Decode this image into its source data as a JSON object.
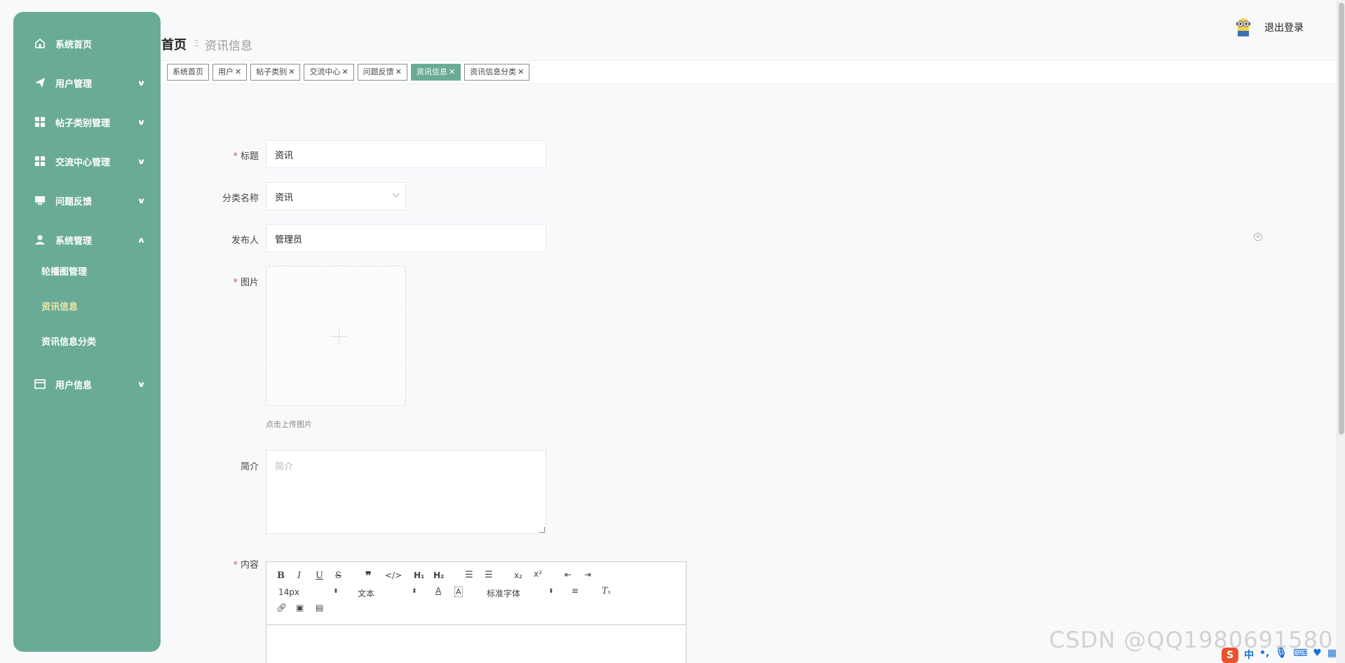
{
  "sidebar": {
    "items": [
      {
        "label": "系统首页",
        "icon": "home-icon"
      },
      {
        "label": "用户管理",
        "icon": "send-icon"
      },
      {
        "label": "帖子类别管理",
        "icon": "grid-icon"
      },
      {
        "label": "交流中心管理",
        "icon": "grid-icon"
      },
      {
        "label": "问题反馈",
        "icon": "monitor-icon"
      },
      {
        "label": "系统管理",
        "icon": "user-icon"
      },
      {
        "label": "用户信息",
        "icon": "card-icon"
      }
    ],
    "sub_items": [
      "轮播图管理",
      "资讯信息",
      "资讯信息分类"
    ],
    "active_sub": "资讯信息"
  },
  "header": {
    "breadcrumb_home": "首页",
    "breadcrumb_sep": "Ξ",
    "breadcrumb_current": "资讯信息",
    "logout": "退出登录"
  },
  "tags": [
    {
      "label": "系统首页",
      "closable": false
    },
    {
      "label": "用户",
      "closable": true
    },
    {
      "label": "帖子类别",
      "closable": true
    },
    {
      "label": "交流中心",
      "closable": true
    },
    {
      "label": "问题反馈",
      "closable": true
    },
    {
      "label": "资讯信息",
      "closable": true,
      "active": true
    },
    {
      "label": "资讯信息分类",
      "closable": true
    }
  ],
  "form": {
    "title_label": "标题",
    "title_value": "资讯",
    "category_label": "分类名称",
    "category_value": "资讯",
    "publisher_label": "发布人",
    "publisher_value": "管理员",
    "image_label": "图片",
    "upload_tip": "点击上传图片",
    "intro_label": "简介",
    "intro_placeholder": "简介",
    "content_label": "内容"
  },
  "editor": {
    "font_size": "14px",
    "header_picker": "文本",
    "font_family": "标准字体"
  },
  "watermark": "CSDN @QQ1980691580",
  "ime": {
    "logo": "S",
    "lang": "中"
  },
  "colors": {
    "sidebar": "#6aab98",
    "active_tag": "#6aab98",
    "required": "#e84c4c",
    "active_sub": "#f4e6a3"
  }
}
